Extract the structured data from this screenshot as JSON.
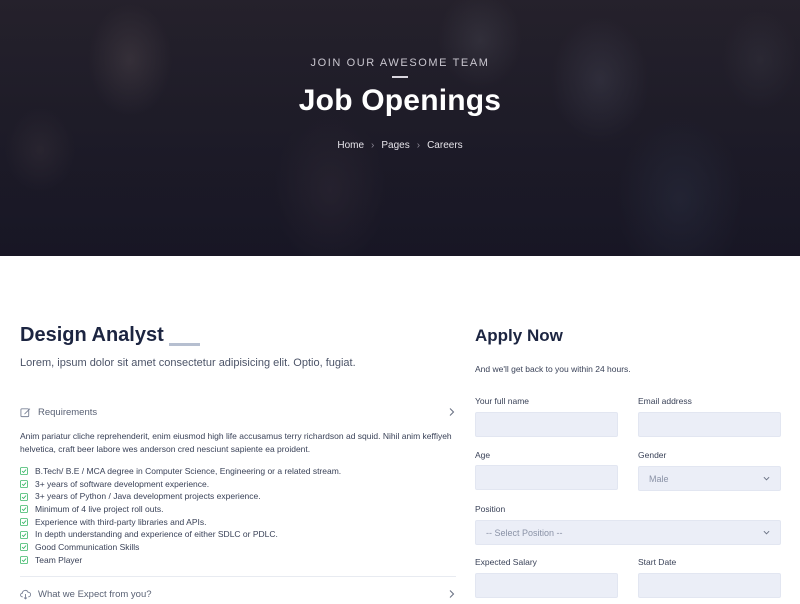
{
  "hero": {
    "kicker": "JOIN OUR AWESOME TEAM",
    "title": "Job Openings",
    "breadcrumb": [
      "Home",
      "Pages",
      "Careers"
    ]
  },
  "job": {
    "title": "Design Analyst",
    "subtitle": "Lorem, ipsum dolor sit amet consectetur adipisicing elit. Optio, fugiat.",
    "sections": [
      {
        "label": "Requirements",
        "icon": "edit-icon",
        "text": "Anim pariatur cliche reprehenderit, enim eiusmod high life accusamus terry richardson ad squid. Nihil anim keffiyeh helvetica, craft beer labore wes anderson cred nesciunt sapiente ea proident.",
        "items": [
          "B.Tech/ B.E / MCA degree in Computer Science, Engineering or a related stream.",
          "3+ years of software development experience.",
          "3+ years of Python / Java development projects experience.",
          "Minimum of 4 live project roll outs.",
          "Experience with third-party libraries and APIs.",
          "In depth understanding and experience of either SDLC or PDLC.",
          "Good Communication Skills",
          "Team Player"
        ]
      },
      {
        "label": "What we Expect from you?",
        "icon": "cloud-download-icon"
      }
    ]
  },
  "apply": {
    "title": "Apply Now",
    "subtitle": "And we'll get back to you within 24 hours.",
    "fields": {
      "full_name": {
        "label": "Your full name",
        "value": ""
      },
      "email": {
        "label": "Email address",
        "value": ""
      },
      "age": {
        "label": "Age",
        "value": ""
      },
      "gender": {
        "label": "Gender",
        "selected": "Male"
      },
      "position": {
        "label": "Position",
        "selected": "-- Select Position --"
      },
      "salary": {
        "label": "Expected Salary",
        "value": ""
      },
      "start_date": {
        "label": "Start Date",
        "value": ""
      }
    }
  },
  "colors": {
    "heading": "#1c2541",
    "input_bg": "#ebeef7",
    "check": "#3db96a"
  }
}
